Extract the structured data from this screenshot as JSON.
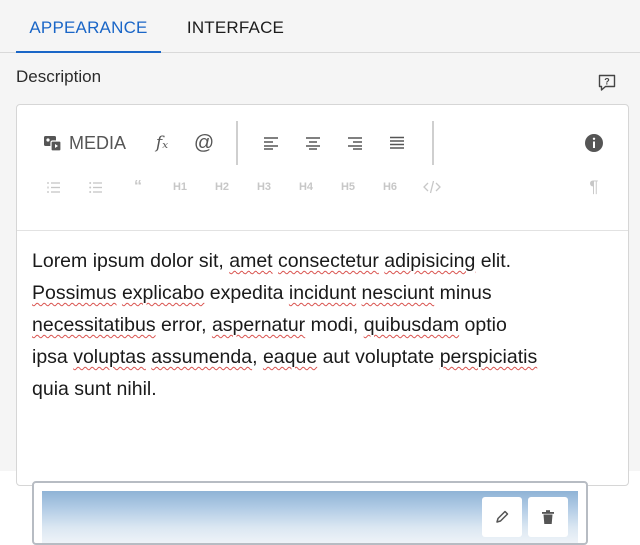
{
  "tabs": [
    {
      "label": "APPEARANCE",
      "active": true
    },
    {
      "label": "INTERFACE",
      "active": false
    }
  ],
  "field": {
    "label": "Description",
    "help_icon": "help-speech-bubble-icon"
  },
  "toolbar": {
    "media_label": "MEDIA",
    "media_icon": "media-icon",
    "fx_label": "fₓ",
    "at_label": "@",
    "align_buttons": [
      "align-left-icon",
      "align-center-icon",
      "align-right-icon",
      "align-justify-icon"
    ],
    "info_icon": "info-icon",
    "format_buttons": [
      "ordered-list-icon",
      "bullet-list-icon",
      "blockquote-icon",
      "H1",
      "H2",
      "H3",
      "H4",
      "H5",
      "H6",
      "code-icon"
    ],
    "pilcrow_icon": "pilcrow-icon"
  },
  "content": {
    "lines": [
      "Lorem ipsum dolor sit, amet consectetur adipisicing elit.",
      "Possimus explicabo expedita incidunt nesciunt minus",
      "necessitatibus error, aspernatur modi, quibusdam optio",
      "ipsa voluptas assumenda, eaque aut voluptate perspiciatis",
      "quia sunt nihil."
    ]
  },
  "image_block": {
    "edit_icon": "pencil-icon",
    "delete_icon": "trash-icon"
  },
  "colors": {
    "accent": "#1a66c7",
    "background": "#f5f5f5",
    "editor_bg": "#ffffff",
    "disabled_icon": "#c7c7c7"
  }
}
